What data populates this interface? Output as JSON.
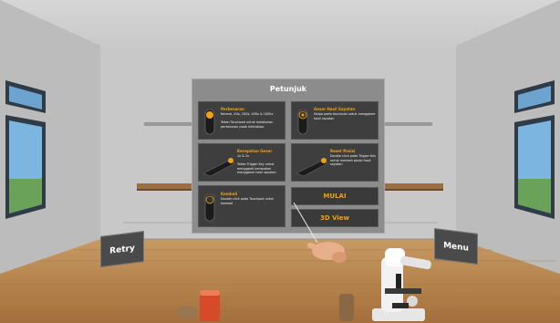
{
  "panel": {
    "title": "Petunjuk",
    "cards": [
      {
        "title": "Perbesaran",
        "text": "Normal, 40x, 100x, 400x & 1000x\n\nTekan Touchpad untuk melakukan perbesaran pada mikroskop",
        "icon": "touchpad-controller-icon"
      },
      {
        "title": "Geser Hasil Sayatan",
        "text": "Swipe pada touchpad untuk menggeser hasil sayatan",
        "icon": "touchpad-swipe-controller-icon"
      },
      {
        "title": "Kecepatan Geser",
        "text": "1x & 2x\n\nTekan Trigger Key untuk mengganti kecepatan menggeser hasil sayatan",
        "icon": "trigger-controller-icon"
      },
      {
        "title": "Reset Posisi",
        "text": "Double click pada Trigger Key untuk mereset posisi hasil sayatan",
        "icon": "trigger-reset-controller-icon"
      },
      {
        "title": "Kembali",
        "text": "Double click pada Touchpad untuk kembali",
        "icon": "touchpad-back-controller-icon"
      }
    ],
    "start_label": "MULAI",
    "view3d_label": "3D View"
  },
  "signs": {
    "retry_label": "Retry",
    "menu_label": "Menu"
  },
  "colors": {
    "accent": "#f0a01a",
    "card_bg": "#3e3e3e",
    "panel_bg": "#8c8c8c"
  }
}
